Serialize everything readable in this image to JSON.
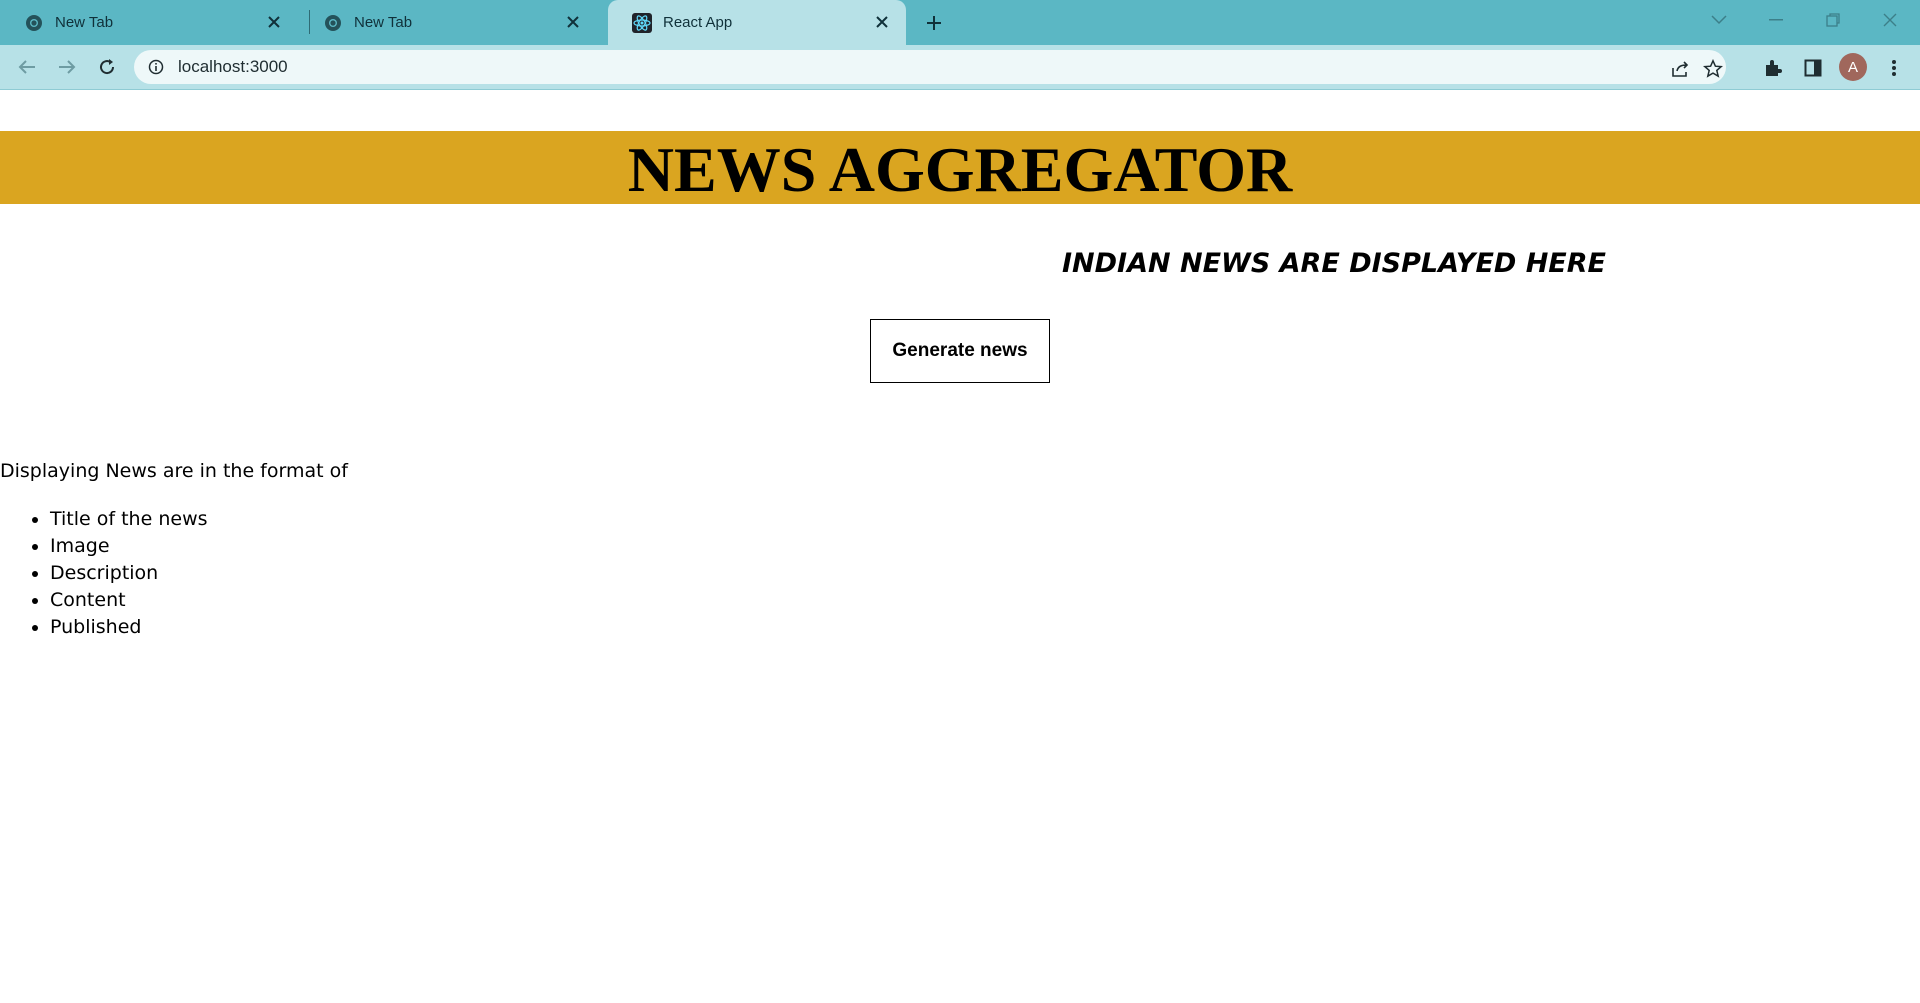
{
  "browser": {
    "tabs": [
      {
        "label": "New Tab",
        "favicon": "chrome-icon",
        "active": false
      },
      {
        "label": "New Tab",
        "favicon": "chrome-icon",
        "active": false
      },
      {
        "label": "React App",
        "favicon": "react-icon",
        "active": true
      }
    ],
    "address": {
      "url": "localhost:3000"
    },
    "avatar_initial": "A",
    "colors": {
      "tabstrip": "#5bb7c4",
      "toolbar": "#b7e1e7"
    }
  },
  "page": {
    "banner": {
      "title": "NEWS AGGREGATOR",
      "color": "#daa520"
    },
    "subtitle": "INDIAN NEWS ARE DISPLAYED HERE",
    "generate_button": "Generate news",
    "format_intro": "Displaying News are in the format of",
    "format_items": [
      "Title of the news",
      "Image",
      "Description",
      "Content",
      "Published"
    ]
  }
}
